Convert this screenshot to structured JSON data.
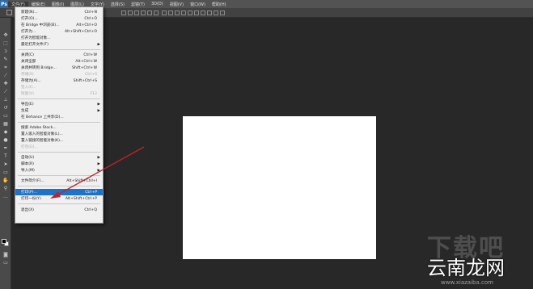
{
  "app": {
    "logo": "Ps"
  },
  "menubar": {
    "items": [
      "文件(F)",
      "编辑(E)",
      "图像(I)",
      "图层(L)",
      "文字(Y)",
      "选择(S)",
      "滤镜(T)",
      "3D(D)",
      "视图(V)",
      "窗口(W)",
      "帮助(H)"
    ],
    "active_index": 0
  },
  "file_menu": {
    "items": [
      {
        "label": "新建(N)...",
        "shortcut": "Ctrl+N"
      },
      {
        "label": "打开(O)...",
        "shortcut": "Ctrl+O"
      },
      {
        "label": "在 Bridge 中浏览(B)...",
        "shortcut": "Alt+Ctrl+O"
      },
      {
        "label": "打开为...",
        "shortcut": "Alt+Shift+Ctrl+O"
      },
      {
        "label": "打开为智能对象...",
        "shortcut": ""
      },
      {
        "label": "最近打开文件(T)",
        "shortcut": ""
      },
      {
        "label": "关闭(C)",
        "shortcut": "Ctrl+W"
      },
      {
        "label": "关闭全部",
        "shortcut": "Alt+Ctrl+W"
      },
      {
        "label": "关闭并转到 Bridge...",
        "shortcut": "Shift+Ctrl+W"
      },
      {
        "label": "存储(S)",
        "shortcut": "Ctrl+S"
      },
      {
        "label": "存储为(A)...",
        "shortcut": "Shift+Ctrl+S"
      },
      {
        "label": "签入(I)...",
        "shortcut": ""
      },
      {
        "label": "恢复(V)",
        "shortcut": "F12"
      },
      {
        "label": "导出(E)",
        "shortcut": ""
      },
      {
        "label": "生成",
        "shortcut": ""
      },
      {
        "label": "在 Behance 上共享(D)...",
        "shortcut": ""
      },
      {
        "label": "搜索 Adobe Stock...",
        "shortcut": ""
      },
      {
        "label": "置入嵌入的智能对象(L)...",
        "shortcut": ""
      },
      {
        "label": "置入链接的智能对象(K)...",
        "shortcut": ""
      },
      {
        "label": "打包(G)...",
        "shortcut": ""
      },
      {
        "label": "自动(U)",
        "shortcut": ""
      },
      {
        "label": "脚本(R)",
        "shortcut": ""
      },
      {
        "label": "导入(M)",
        "shortcut": ""
      },
      {
        "label": "文件简介(F)...",
        "shortcut": "Alt+Shift+Ctrl+I"
      },
      {
        "label": "打印(P)...",
        "shortcut": "Ctrl+P"
      },
      {
        "label": "打印一份(Y)",
        "shortcut": "Alt+Shift+Ctrl+P"
      },
      {
        "label": "退出(X)",
        "shortcut": "Ctrl+Q"
      }
    ]
  },
  "watermark": {
    "big": "下载吧",
    "main": "云南龙网",
    "url": "www.xiazaiba.com"
  },
  "colors": {
    "selection": "#1d73c9",
    "annotation_arrow": "#c0222a",
    "workspace": "#282828"
  }
}
